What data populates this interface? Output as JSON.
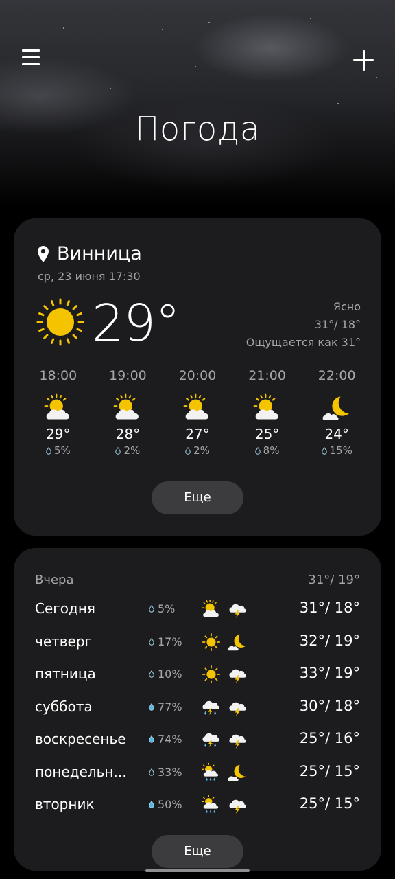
{
  "header": {
    "title": "Погода"
  },
  "current": {
    "city": "Винница",
    "datetime": "ср, 23 июня 17:30",
    "temp": "29°",
    "condition": "Ясно",
    "hi_lo": "31°/ 18°",
    "feels_like": "Ощущается как 31°"
  },
  "hourly": [
    {
      "time": "18:00",
      "icon": "sun-cloud-icon",
      "temp": "29°",
      "precip": "5%"
    },
    {
      "time": "19:00",
      "icon": "sun-cloud-icon",
      "temp": "28°",
      "precip": "2%"
    },
    {
      "time": "20:00",
      "icon": "sun-cloud-icon",
      "temp": "27°",
      "precip": "2%"
    },
    {
      "time": "21:00",
      "icon": "sun-cloud-icon",
      "temp": "25°",
      "precip": "8%"
    },
    {
      "time": "22:00",
      "icon": "moon-cloud-icon",
      "temp": "24°",
      "precip": "15%"
    }
  ],
  "more_label": "Еще",
  "yesterday": {
    "label": "Вчера",
    "temps": "31°/ 19°"
  },
  "daily": [
    {
      "day": "Сегодня",
      "precip": "5%",
      "day_icon": "sun-cloud-icon",
      "night_icon": "storm-icon",
      "temps": "31°/ 18°"
    },
    {
      "day": "четверг",
      "precip": "17%",
      "day_icon": "sun-icon",
      "night_icon": "moon-cloud-icon",
      "temps": "32°/ 19°"
    },
    {
      "day": "пятница",
      "precip": "10%",
      "day_icon": "sun-icon",
      "night_icon": "storm-icon",
      "temps": "33°/ 19°"
    },
    {
      "day": "суббота",
      "precip": "77%",
      "day_icon": "rain-storm-icon",
      "night_icon": "storm-icon",
      "temps": "30°/ 18°"
    },
    {
      "day": "воскресенье",
      "precip": "74%",
      "day_icon": "rain-storm-icon",
      "night_icon": "storm-icon",
      "temps": "25°/ 16°"
    },
    {
      "day": "понедельн...",
      "precip": "33%",
      "day_icon": "sun-rain-icon",
      "night_icon": "moon-cloud-icon",
      "temps": "25°/ 15°"
    },
    {
      "day": "вторник",
      "precip": "50%",
      "day_icon": "sun-rain-icon",
      "night_icon": "storm-icon",
      "temps": "25°/ 15°"
    }
  ],
  "colors": {
    "sun": "#f5c400",
    "card": "#1c1c1e",
    "button": "#3c3c3e",
    "secondary_text": "#a6a6a8",
    "drop_light": "#9fd3e8",
    "drop_blue": "#5ab4e0"
  }
}
